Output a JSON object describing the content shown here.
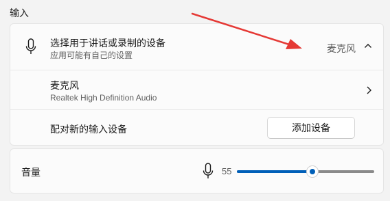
{
  "section": {
    "title": "输入"
  },
  "input_device": {
    "title": "选择用于讲话或录制的设备",
    "subtitle": "应用可能有自己的设置",
    "selected": "麦克风",
    "expanded": true
  },
  "microphone": {
    "name": "麦克风",
    "driver": "Realtek High Definition Audio"
  },
  "pair_new": {
    "label": "配对新的输入设备",
    "button_label": "添加设备"
  },
  "volume": {
    "label": "音量",
    "value": "55",
    "level": 0.55
  },
  "colors": {
    "accent": "#005fb8",
    "annotation_arrow": "#e53935"
  },
  "icons": {
    "device": "microphone-icon",
    "expand": "chevron-up-icon",
    "open": "chevron-right-icon"
  }
}
